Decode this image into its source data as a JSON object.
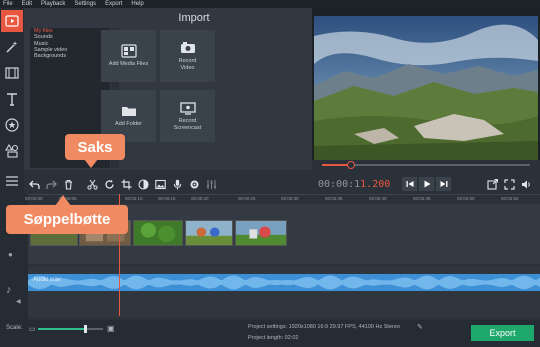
{
  "menu": [
    "File",
    "Edit",
    "Playback",
    "Settings",
    "Export",
    "Help"
  ],
  "rail_icons": [
    "media-import-icon",
    "magic-wand-icon",
    "filmstrip-icon",
    "titles-icon",
    "star-icon",
    "shapes-icon",
    "more-menu-icon"
  ],
  "import": {
    "title": "Import",
    "files": [
      "My files",
      "Sounds",
      "Music",
      "Sample video",
      "Backgrounds"
    ],
    "tiles": {
      "add_media": "Add Media Files",
      "record_video": "Record Video",
      "add_folder": "Add Folder",
      "record_screencast": "Record Screencast"
    }
  },
  "preview": {
    "progress": 0.14
  },
  "timecode": {
    "main": "00:00:1",
    "ms": "1.200"
  },
  "ruler": [
    "00:00:00",
    "00:00:05",
    "00:00:10",
    "00:00:15",
    "00:00:20",
    "00:00:25",
    "00:00:30",
    "00:00:35",
    "00:00:40",
    "00:00:45",
    "00:00:50",
    "00:00:55"
  ],
  "audio": {
    "label": "Audio.wav"
  },
  "footer": {
    "scale_label": "Scale:",
    "scale_value": 0.72,
    "settings": "Project settings:  1920x1080 16:9 29.97 FPS, 44100 Hz Stereo",
    "length": "Project length:   02:02",
    "export": "Export"
  },
  "callouts": {
    "saks": "Saks",
    "soppelbotte": "Søppelbøtte"
  },
  "colors": {
    "accent": "#e8573f",
    "export": "#1fa86c",
    "audio": "#3d8fd6",
    "callout": "#f08a62"
  }
}
